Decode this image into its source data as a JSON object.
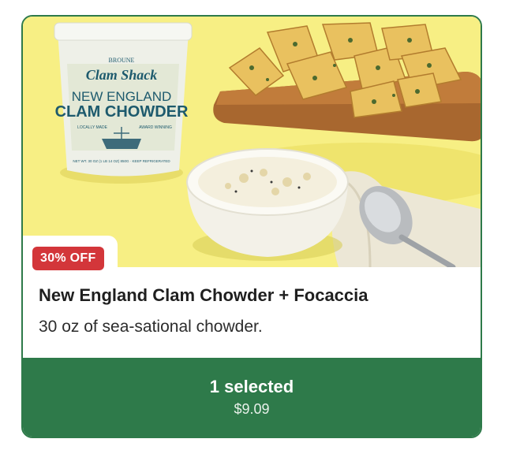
{
  "product": {
    "discount_badge": "30% OFF",
    "title": "New England Clam Chowder + Focaccia",
    "subtitle": "30 oz of sea-sational chowder."
  },
  "hero_image": {
    "label_brand_top": "BROUNE",
    "label_brand": "Clam Shack",
    "label_line1": "NEW ENGLAND",
    "label_line2": "CLAM CHOWDER",
    "label_small_left": "LOCALLY MADE",
    "label_small_right": "AWARD WINNING",
    "label_bottom": "NET WT. 30 OZ (1 LB 14 OZ) 850G · KEEP REFRIGERATED"
  },
  "selection": {
    "count_label": "1 selected",
    "price": "$9.09"
  },
  "colors": {
    "accent_green": "#2e7a4a",
    "badge_red": "#d3363a",
    "hero_yellow": "#f7ef84"
  }
}
